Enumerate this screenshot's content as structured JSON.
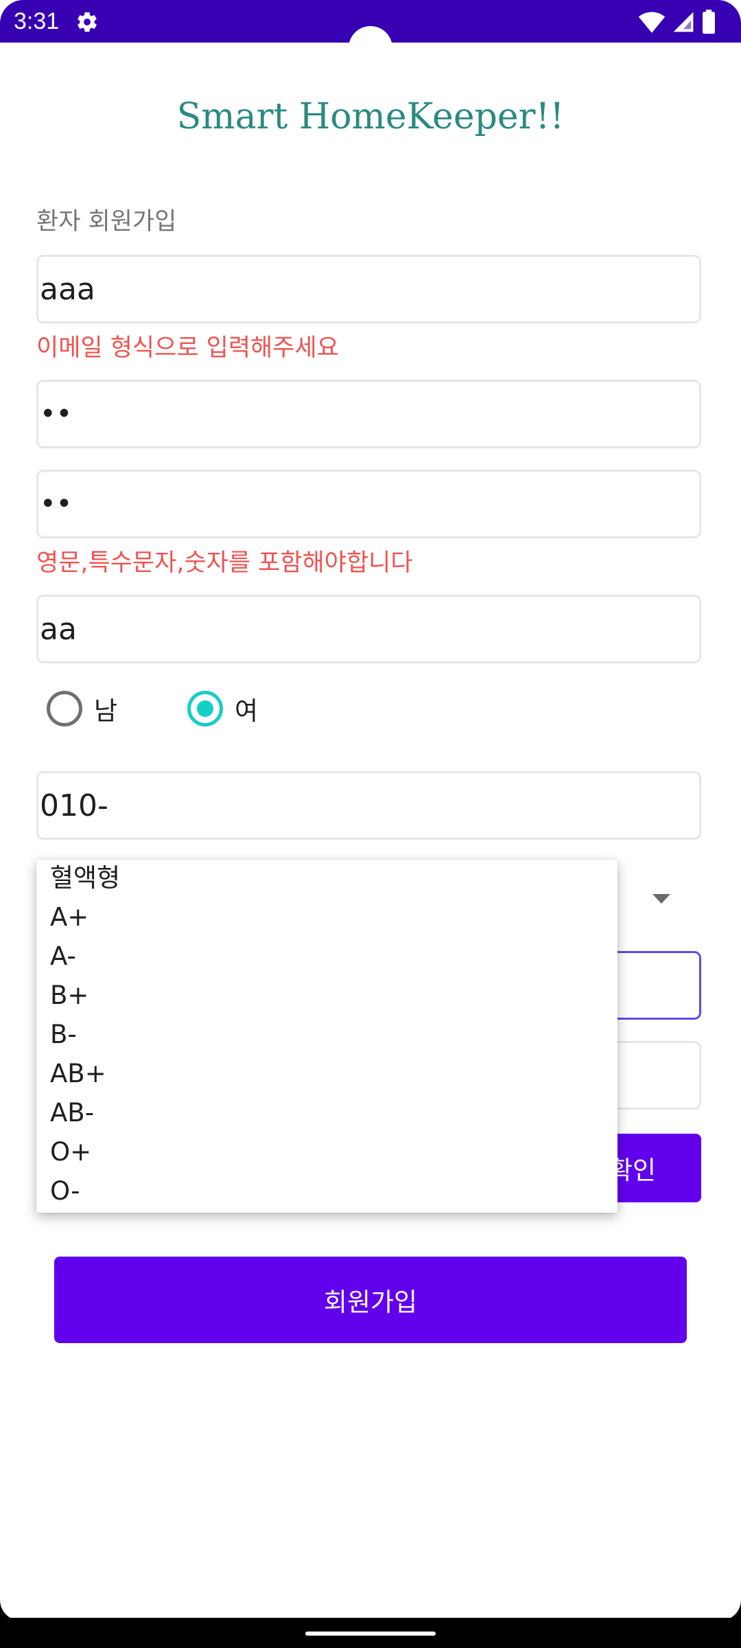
{
  "status_bar": {
    "time": "3:31",
    "icons": [
      "settings-gear-icon",
      "wifi-icon",
      "signal-icon",
      "battery-icon"
    ]
  },
  "app": {
    "title": "Smart HomeKeeper!!"
  },
  "form": {
    "section_label": "환자 회원가입",
    "email_value": "aaa",
    "email_error": "이메일 형식으로 입력해주세요",
    "password_value": "••",
    "password_confirm_value": "••",
    "password_error": "영문,특수문자,숫자를 포함해야합니다",
    "name_value": "aa",
    "gender": {
      "male_label": "남",
      "female_label": "여",
      "selected": "여"
    },
    "phone_value": "010-",
    "verify_button_label": "확인",
    "submit_button_label": "회원가입"
  },
  "blood_type_dropdown": {
    "options": [
      "혈액형",
      "A+",
      "A-",
      "B+",
      "B-",
      "AB+",
      "AB-",
      "O+",
      "O-"
    ]
  },
  "colors": {
    "status_bar": "#3700b3",
    "title": "#2a8a80",
    "error": "#ef5350",
    "primary_button": "#6200ee",
    "radio_selected": "#14cfc6",
    "focused_border": "#5b4fe0"
  }
}
